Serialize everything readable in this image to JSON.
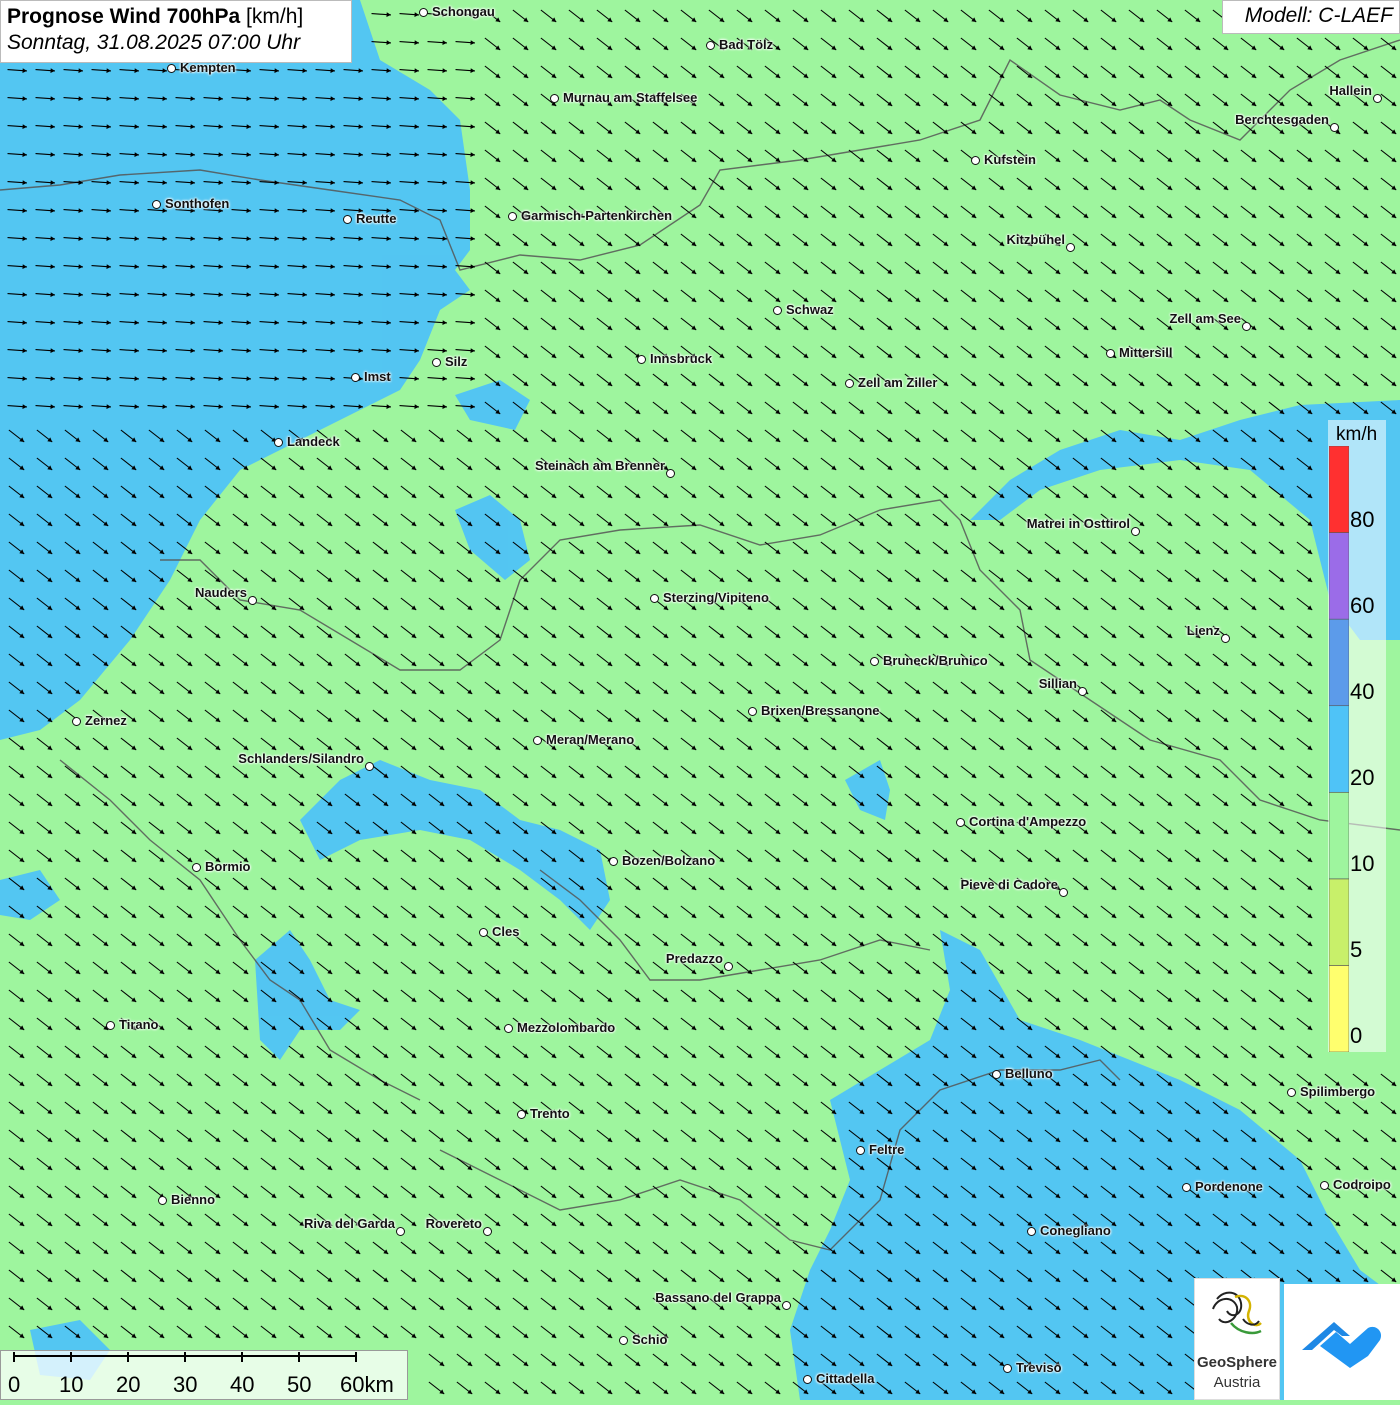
{
  "header": {
    "title_bold": "Prognose Wind 700hPa",
    "title_unit": "[km/h]",
    "subtitle": "Sonntag, 31.08.2025 07:00 Uhr",
    "model": "Modell: C-LAEF"
  },
  "colors": {
    "land_wind_10_20": "#9ef59e",
    "wind_20_40": "#4fc3f7",
    "wind_40_60": "#5c9bea",
    "wind_60_80": "#9b6ce8",
    "wind_80_plus": "#ff3030",
    "wind_5_10": "#c8f06a",
    "wind_0_5": "#ffff6e",
    "arrow": "#000000",
    "border_line": "#555555"
  },
  "legend": {
    "unit": "km/h",
    "labels": [
      "80",
      "60",
      "40",
      "20",
      "10",
      "5",
      "0"
    ],
    "bins": [
      {
        "from": 0,
        "to": 5,
        "color": "#ffff6e"
      },
      {
        "from": 5,
        "to": 10,
        "color": "#c8f06a"
      },
      {
        "from": 10,
        "to": 20,
        "color": "#9ef59e"
      },
      {
        "from": 20,
        "to": 40,
        "color": "#4fc3f7"
      },
      {
        "from": 40,
        "to": 60,
        "color": "#5c9bea"
      },
      {
        "from": 60,
        "to": 80,
        "color": "#9b6ce8"
      },
      {
        "from": 80,
        "to": 100,
        "color": "#ff3030"
      }
    ]
  },
  "scalebar": {
    "labels": [
      "0",
      "10",
      "20",
      "30",
      "40",
      "50",
      "60km"
    ]
  },
  "wind_field": {
    "dominant_direction": "north-west",
    "north_west_sector": "west"
  },
  "cities": [
    {
      "name": "Schongau"
    },
    {
      "name": "Bad Tölz"
    },
    {
      "name": "Kempten"
    },
    {
      "name": "Murnau am Staffelsee"
    },
    {
      "name": "Hallein"
    },
    {
      "name": "Berchtesgaden"
    },
    {
      "name": "Kufstein"
    },
    {
      "name": "Sonthofen"
    },
    {
      "name": "Reutte"
    },
    {
      "name": "Garmisch-Partenkirchen"
    },
    {
      "name": "Kitzbühel"
    },
    {
      "name": "Schwaz"
    },
    {
      "name": "Zell am See"
    },
    {
      "name": "Innsbruck"
    },
    {
      "name": "Silz"
    },
    {
      "name": "Mittersill"
    },
    {
      "name": "Imst"
    },
    {
      "name": "Zell am Ziller"
    },
    {
      "name": "Landeck"
    },
    {
      "name": "Steinach am Brenner"
    },
    {
      "name": "Matrei in Osttirol"
    },
    {
      "name": "Nauders"
    },
    {
      "name": "Sterzing/Vipiteno"
    },
    {
      "name": "Lienz"
    },
    {
      "name": "Bruneck/Brunico"
    },
    {
      "name": "Sillian"
    },
    {
      "name": "Brixen/Bressanone"
    },
    {
      "name": "Zernez"
    },
    {
      "name": "Meran/Merano"
    },
    {
      "name": "Schlanders/Silandro"
    },
    {
      "name": "Cortina d'Ampezzo"
    },
    {
      "name": "Bozen/Bolzano"
    },
    {
      "name": "Bormio"
    },
    {
      "name": "Pieve di Cadore"
    },
    {
      "name": "Cles"
    },
    {
      "name": "Predazzo"
    },
    {
      "name": "Tirano"
    },
    {
      "name": "Mezzolombardo"
    },
    {
      "name": "Belluno"
    },
    {
      "name": "Spilimbergo"
    },
    {
      "name": "Trento"
    },
    {
      "name": "Feltre"
    },
    {
      "name": "Bienno"
    },
    {
      "name": "Pordenone"
    },
    {
      "name": "Codroipo"
    },
    {
      "name": "Riva del Garda"
    },
    {
      "name": "Rovereto"
    },
    {
      "name": "Conegliano"
    },
    {
      "name": "Bassano del Grappa"
    },
    {
      "name": "Schio"
    },
    {
      "name": "Treviso"
    },
    {
      "name": "Cittadella"
    }
  ],
  "logos": {
    "geosphere_line1": "GeoSphere",
    "geosphere_line2": "Austria",
    "geosphere_icon": "geosphere-swirl-icon",
    "partner_icon": "blue-cloud-arrow-icon"
  }
}
